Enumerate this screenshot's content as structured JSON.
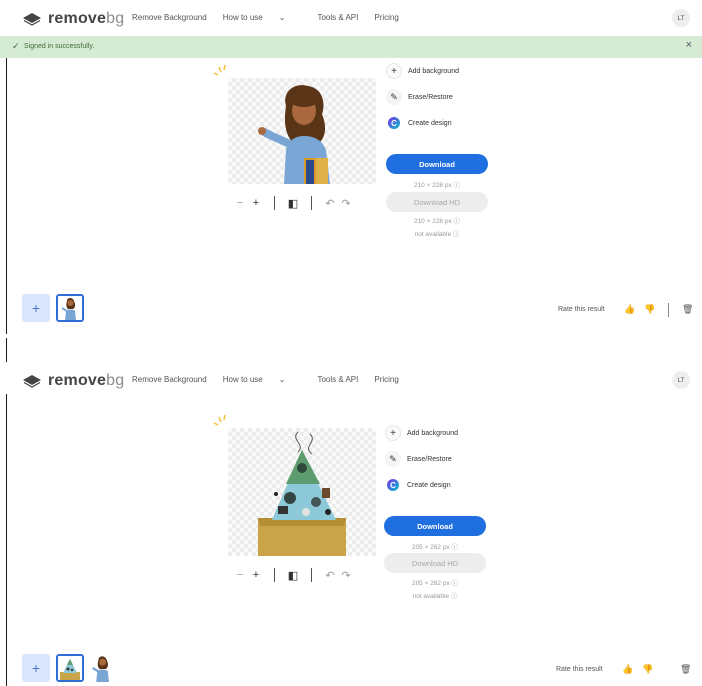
{
  "app": {
    "logo_main": "remove",
    "logo_suffix": "bg",
    "nav": [
      "Remove Background",
      "How to use",
      "Tools & API",
      "Pricing"
    ],
    "avatar_initials": "LT"
  },
  "banner": {
    "message": "Signed in successfully."
  },
  "panel_labels": {
    "add_background": "Add background",
    "erase_restore": "Erase/Restore",
    "create_design": "Create design",
    "download": "Download",
    "download_hd": "Download HD",
    "not_available": "not available"
  },
  "frame1": {
    "download_size": "210 × 228 px",
    "download_hd_size": "210 × 228 px"
  },
  "frame2": {
    "download_size": "205 × 262 px",
    "download_hd_size": "205 × 262 px"
  },
  "bottom": {
    "rate_label": "Rate this result"
  },
  "icons": {
    "info": "info-icon",
    "thumbs_up": "thumbs-up-icon",
    "thumbs_down": "thumbs-down-icon",
    "trash": "trash-icon",
    "undo": "undo-icon",
    "redo": "redo-icon",
    "compare": "compare-icon",
    "zoom_in": "zoom-in-icon",
    "zoom_out": "zoom-out-icon"
  },
  "colors": {
    "primary": "#1f6fe0",
    "banner_bg": "#d6ebd3",
    "selected_border": "#2d6fd6"
  }
}
